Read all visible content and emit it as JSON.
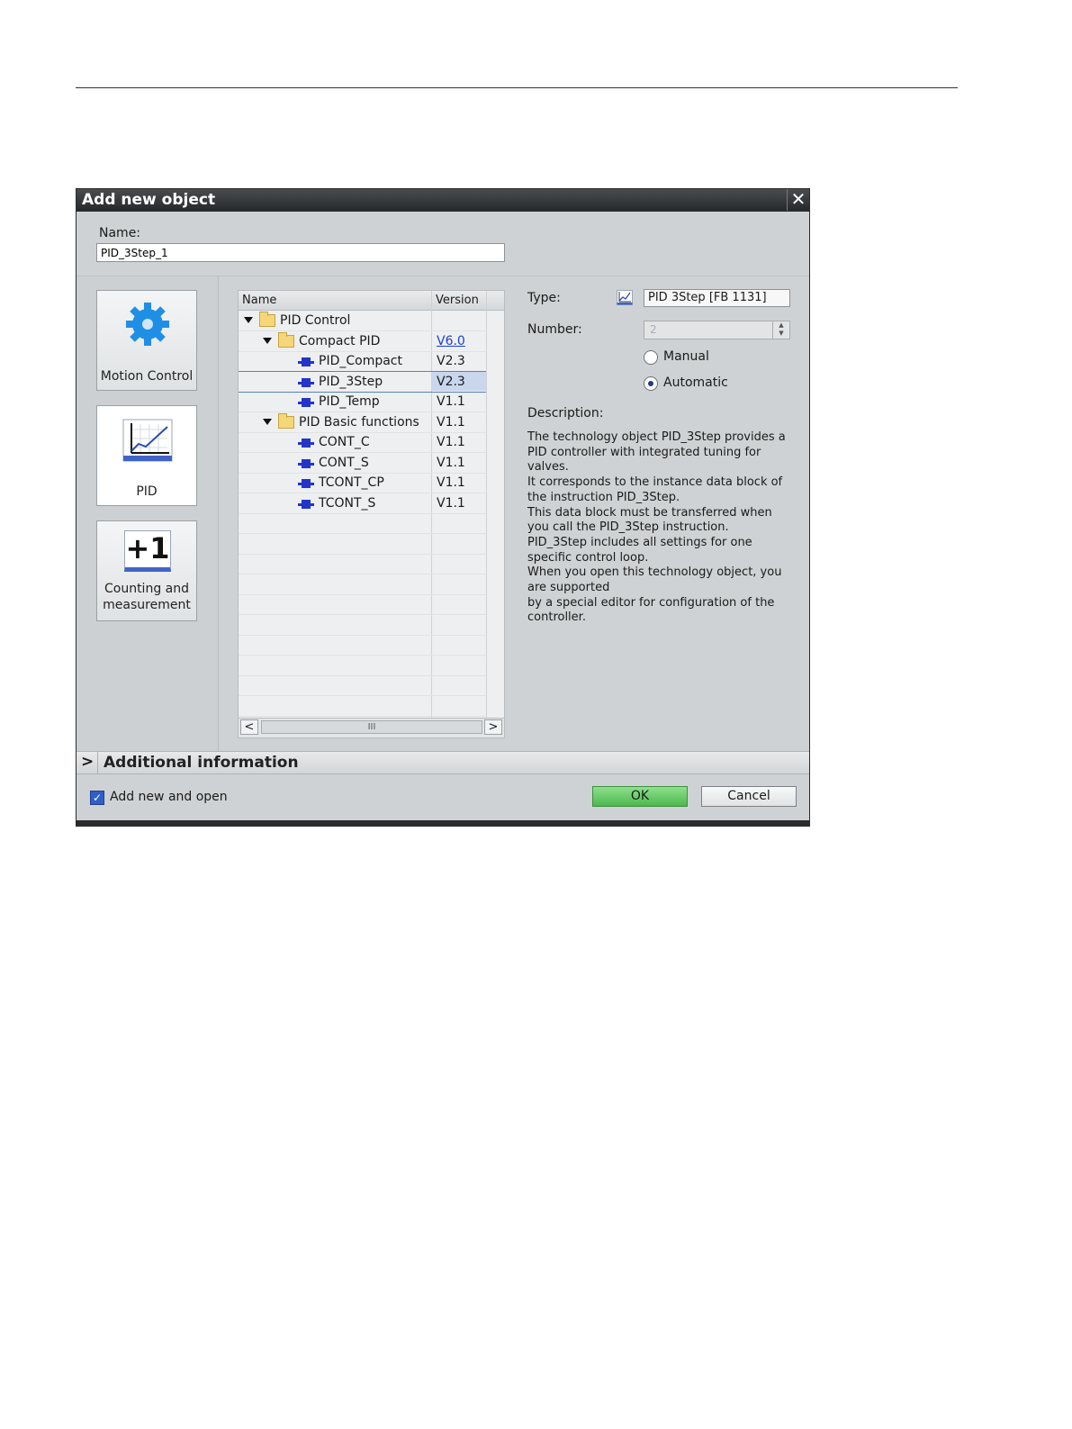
{
  "dialog": {
    "title": "Add new object",
    "close_symbol": "✕",
    "name_label": "Name:",
    "name_value": "PID_3Step_1"
  },
  "categories": [
    {
      "label": "Motion Control",
      "icon": "gear-icon"
    },
    {
      "label": "PID",
      "icon": "pid-chart-icon"
    },
    {
      "label_line1": "Counting and",
      "label_line2": "measurement",
      "icon": "plus-one-icon",
      "icon_text": "+1"
    }
  ],
  "tree": {
    "col_name": "Name",
    "col_version": "Version",
    "rows": [
      {
        "label": "PID Control",
        "version": ""
      },
      {
        "label": "Compact PID",
        "version": "V6.0"
      },
      {
        "label": "PID_Compact",
        "version": "V2.3"
      },
      {
        "label": "PID_3Step",
        "version": "V2.3"
      },
      {
        "label": "PID_Temp",
        "version": "V1.1"
      },
      {
        "label": "PID Basic functions",
        "version": "V1.1"
      },
      {
        "label": "CONT_C",
        "version": "V1.1"
      },
      {
        "label": "CONT_S",
        "version": "V1.1"
      },
      {
        "label": "TCONT_CP",
        "version": "V1.1"
      },
      {
        "label": "TCONT_S",
        "version": "V1.1"
      }
    ],
    "scroll_left": "<",
    "scroll_right": ">",
    "scroll_grip": "III"
  },
  "details": {
    "type_label": "Type:",
    "type_value": "PID 3Step [FB 1131]",
    "number_label": "Number:",
    "number_value": "2",
    "radio_manual": "Manual",
    "radio_automatic": "Automatic",
    "radio_selected": "Automatic",
    "description_label": "Description:",
    "description_lines": [
      "The technology object PID_3Step provides a",
      "PID controller with integrated tuning for",
      "valves.",
      "It corresponds to the instance data block of",
      "the instruction PID_3Step.",
      "This data block must be transferred when",
      "you call the PID_3Step instruction.",
      "PID_3Step includes all settings for one",
      "specific control loop.",
      "When you open this technology object, you",
      "are supported",
      "by a special editor for configuration of the",
      "controller."
    ]
  },
  "additional_info": {
    "chevron": ">",
    "label": "Additional  information"
  },
  "footer": {
    "checkbox_label": "Add new and open",
    "checkbox_checked": true,
    "ok_label": "OK",
    "cancel_label": "Cancel"
  },
  "colors": {
    "ok_button": "#4db84d",
    "selection": "#c9d7ee",
    "link": "#1a3fd8",
    "titlebar": "#25282a"
  }
}
